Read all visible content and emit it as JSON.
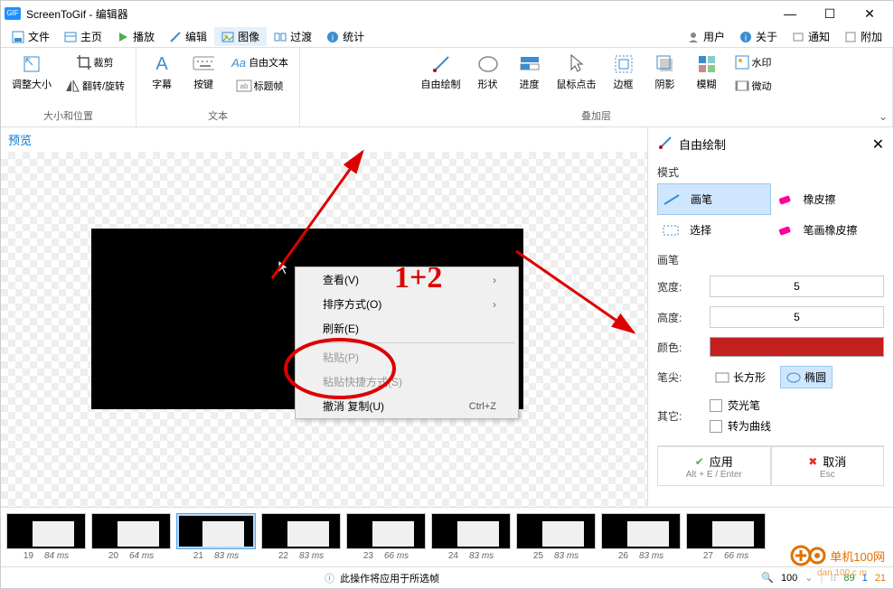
{
  "window": {
    "title": "ScreenToGif - 编辑器",
    "app_badge": "GIF"
  },
  "menu": {
    "file": "文件",
    "home": "主页",
    "play": "播放",
    "edit": "编辑",
    "image": "图像",
    "transition": "过渡",
    "stats": "统计",
    "user": "用户",
    "about": "关于",
    "notify": "通知",
    "attach": "附加"
  },
  "ribbon": {
    "group1_label": "大小和位置",
    "resize": "调整大小",
    "crop": "裁剪",
    "flip": "翻转/旋转",
    "group2_label": "文本",
    "caption": "字幕",
    "keypress": "按键",
    "freetext": "自由文本",
    "titleframe": "标题帧",
    "group3_label": "叠加层",
    "freedraw": "自由绘制",
    "shape": "形状",
    "progress": "进度",
    "mouseclick": "鼠标点击",
    "border": "边框",
    "shadow": "阴影",
    "blur": "模糊",
    "watermark": "水印",
    "cinema": "微动"
  },
  "preview_label": "预览",
  "context_menu": {
    "view": "查看(V)",
    "sort": "排序方式(O)",
    "refresh": "刷新(E)",
    "paste": "粘贴(P)",
    "paste_shortcut": "粘贴快捷方式(S)",
    "undo_copy": "撤消 复制(U)",
    "undo_shortcut": "Ctrl+Z"
  },
  "annotation": "1+2",
  "side": {
    "title": "自由绘制",
    "mode_label": "模式",
    "pen": "画笔",
    "eraser": "橡皮擦",
    "select": "选择",
    "stroke_eraser": "笔画橡皮擦",
    "brush_label": "画笔",
    "width_label": "宽度:",
    "width_val": "5",
    "height_label": "高度:",
    "height_val": "5",
    "color_label": "颜色:",
    "tip_label": "笔尖:",
    "rect": "长方形",
    "ellipse": "椭圆",
    "other_label": "其它:",
    "highlighter": "荧光笔",
    "curve": "转为曲线",
    "apply": "应用",
    "apply_sub": "Alt + E / Enter",
    "cancel": "取消",
    "cancel_sub": "Esc"
  },
  "frames": [
    {
      "idx": "19",
      "ms": "84 ms"
    },
    {
      "idx": "20",
      "ms": "64 ms"
    },
    {
      "idx": "21",
      "ms": "83 ms"
    },
    {
      "idx": "22",
      "ms": "83 ms"
    },
    {
      "idx": "23",
      "ms": "66 ms"
    },
    {
      "idx": "24",
      "ms": "83 ms"
    },
    {
      "idx": "25",
      "ms": "83 ms"
    },
    {
      "idx": "26",
      "ms": "83 ms"
    },
    {
      "idx": "27",
      "ms": "66 ms"
    }
  ],
  "status": {
    "message": "此操作将应用于所选帧",
    "zoom": "100",
    "total": "89",
    "selected": "1",
    "current": "21"
  },
  "watermark": {
    "text": "单机100网",
    "url": "dan 100.c m"
  }
}
